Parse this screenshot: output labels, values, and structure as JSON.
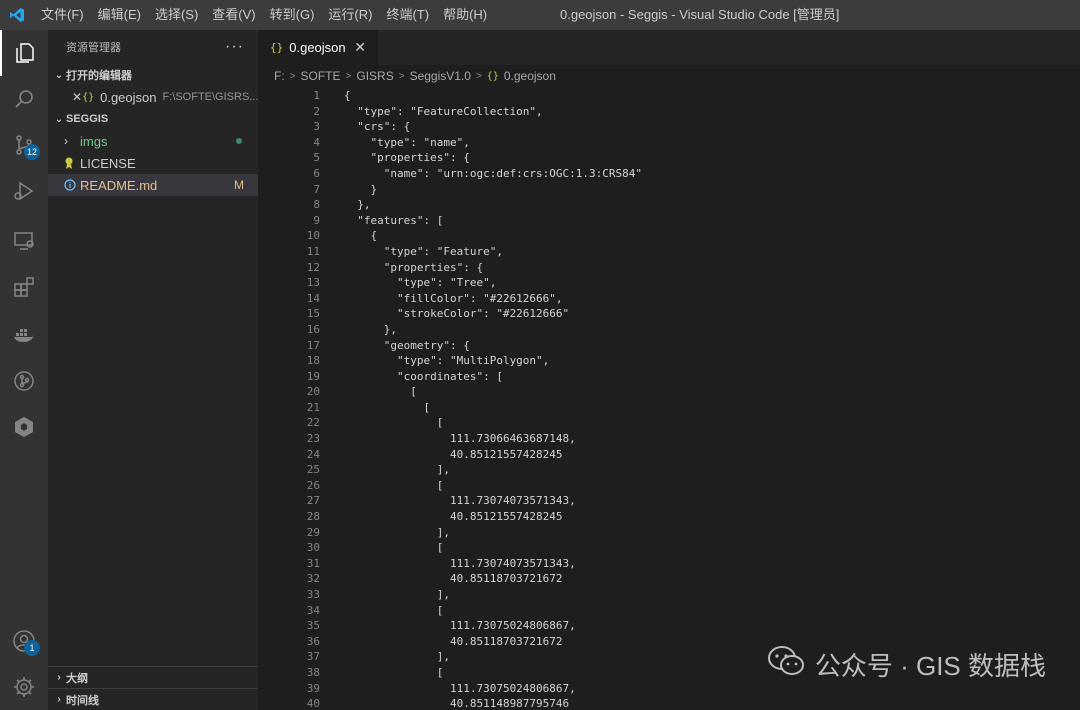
{
  "app": {
    "window_title": "0.geojson - Seggis - Visual Studio Code [管理员]",
    "menu": [
      "文件(F)",
      "编辑(E)",
      "选择(S)",
      "查看(V)",
      "转到(G)",
      "运行(R)",
      "终端(T)",
      "帮助(H)"
    ]
  },
  "activity": {
    "scm_badge": "12",
    "accounts_badge": "1"
  },
  "sidebar": {
    "title": "资源管理器",
    "more": "···",
    "open_editors": {
      "label": "打开的编辑器",
      "items": [
        {
          "close": "✕",
          "icon": "{}",
          "name": "0.geojson",
          "path": "F:\\SOFTE\\GISRS..."
        }
      ]
    },
    "folder": {
      "label": "SEGGIS",
      "items": [
        {
          "name": "imgs",
          "status": ""
        },
        {
          "name": "LICENSE",
          "status": ""
        },
        {
          "name": "README.md",
          "status": "M"
        }
      ]
    },
    "outline_label": "大纲",
    "timeline_label": "时间线"
  },
  "editor": {
    "tab": {
      "icon": "{}",
      "label": "0.geojson",
      "close": "✕"
    },
    "breadcrumb": [
      "F:",
      "SOFTE",
      "GISRS",
      "SeggisV1.0",
      "0.geojson"
    ],
    "breadcrumb_icon": "{}",
    "lines": [
      "{",
      "  \"type\": \"FeatureCollection\",",
      "  \"crs\": {",
      "    \"type\": \"name\",",
      "    \"properties\": {",
      "      \"name\": \"urn:ogc:def:crs:OGC:1.3:CRS84\"",
      "    }",
      "  },",
      "  \"features\": [",
      "    {",
      "      \"type\": \"Feature\",",
      "      \"properties\": {",
      "        \"type\": \"Tree\",",
      "        \"fillColor\": \"#22612666\",",
      "        \"strokeColor\": \"#22612666\"",
      "      },",
      "      \"geometry\": {",
      "        \"type\": \"MultiPolygon\",",
      "        \"coordinates\": [",
      "          [",
      "            [",
      "              [",
      "                111.73066463687148,",
      "                40.85121557428245",
      "              ],",
      "              [",
      "                111.73074073571343,",
      "                40.85121557428245",
      "              ],",
      "              [",
      "                111.73074073571343,",
      "                40.85118703721672",
      "              ],",
      "              [",
      "                111.73075024806867,",
      "                40.85118703721672",
      "              ],",
      "              [",
      "                111.73075024806867,",
      "                40.851148987795746"
    ]
  },
  "watermark": {
    "text": "公众号 · GIS 数据栈"
  },
  "colors": {
    "accent": "#0e639c",
    "json_icon": "#cbcb41",
    "modified": "#e2c08d",
    "untracked": "#73c991",
    "info": "#75beff"
  }
}
